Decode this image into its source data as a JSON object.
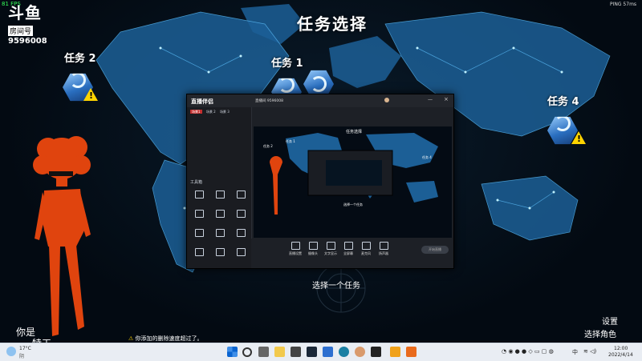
{
  "overlay": {
    "logo_main": "斗鱼",
    "logo_sub": "房间号",
    "room_number": "9596008",
    "fps": "81 FPS",
    "ping": "PING 57ms"
  },
  "game": {
    "title": "任务选择",
    "missions": [
      {
        "label": "任务 2"
      },
      {
        "label": "任务 1"
      },
      {
        "label": "任务 4"
      }
    ],
    "prompt": "选择一个任务",
    "settings_label": "设置",
    "choose_role_label": "选择角色",
    "character_caption_1": "你是",
    "character_caption_2": "特工",
    "notice": "你添加的删除速度超过了。"
  },
  "obs": {
    "app_name": "直播伴侣",
    "room_title": "直播间 9596008",
    "tabs": [
      "场景1",
      "场景 2",
      "场景 3"
    ],
    "tool_title": "工具箱",
    "toolbar": [
      "直播设置",
      "摄像头",
      "文字显示",
      "全屏幕",
      "麦克风",
      "扬声器"
    ],
    "start_button": "开始直播",
    "preview": {
      "title": "任务选择",
      "missions": [
        "任务 1",
        "任务 2",
        "任务 4"
      ],
      "prompt": "选择一个任务"
    }
  },
  "taskbar": {
    "weather_temp": "17°C",
    "weather_desc": "阴",
    "time": "12:00",
    "date": "2022/4/14",
    "accent": "#0a64d0"
  }
}
